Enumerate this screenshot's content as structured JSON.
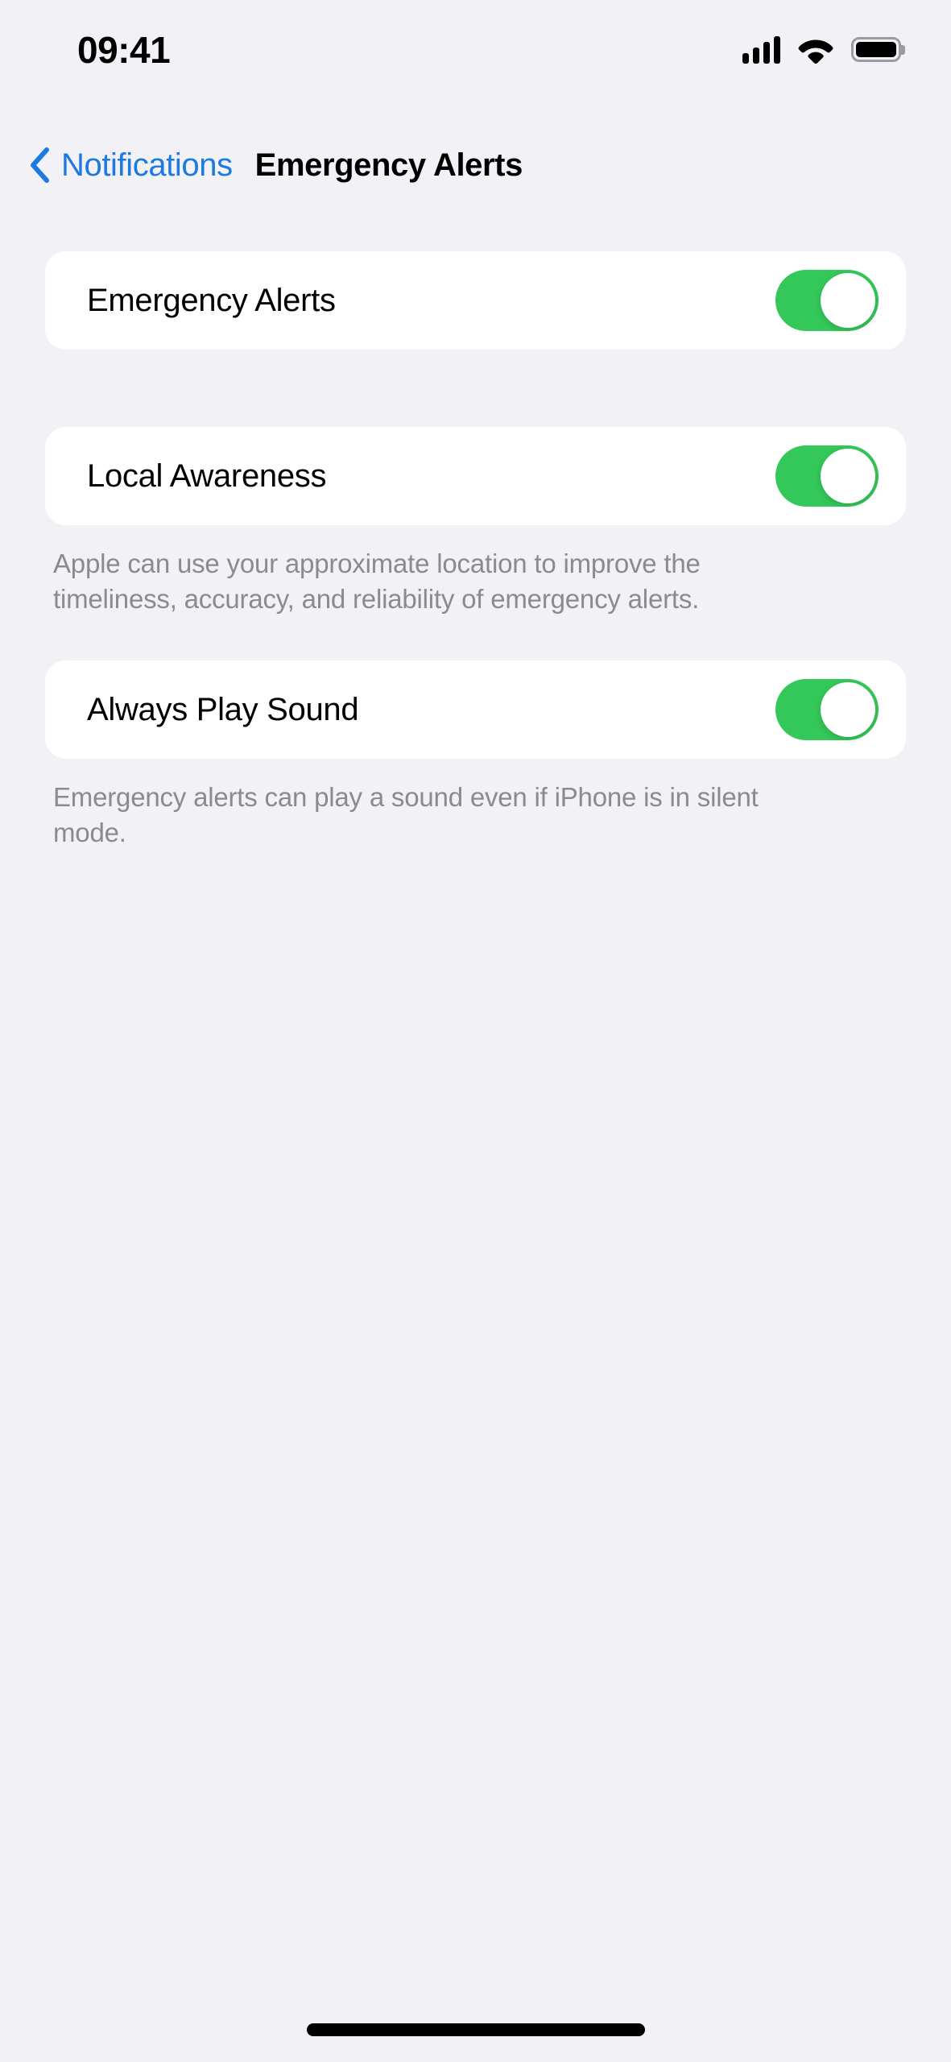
{
  "status_bar": {
    "time": "09:41",
    "cellular_icon": "signal-bars-icon",
    "cellular_bars_filled": 4,
    "wifi_icon": "wifi-icon",
    "battery_icon": "battery-icon",
    "battery_level_percent": 100
  },
  "nav": {
    "back_icon": "chevron-left-icon",
    "back_label": "Notifications",
    "title": "Emergency Alerts"
  },
  "sections": [
    {
      "row_label": "Emergency Alerts",
      "toggle_state": "on",
      "footer": ""
    },
    {
      "row_label": "Local Awareness",
      "toggle_state": "on",
      "footer": "Apple can use your approximate location to improve the timeliness, accuracy, and reliability of emergency alerts."
    },
    {
      "row_label": "Always Play Sound",
      "toggle_state": "on",
      "footer": "Emergency alerts can play a sound even if iPhone is in silent mode."
    }
  ],
  "home_indicator": "home-indicator",
  "colors": {
    "background": "#f2f1f6",
    "card": "#ffffff",
    "toggle_on": "#34c759",
    "accent_link": "#1d7ae0",
    "footer_text": "#8a8a8f",
    "primary_text": "#000000"
  }
}
